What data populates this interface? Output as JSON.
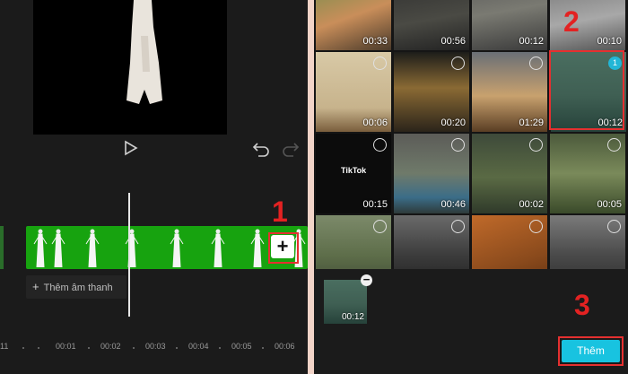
{
  "editor": {
    "timeline_ticks": [
      "11",
      "00:01",
      "00:02",
      "00:03",
      "00:04",
      "00:05",
      "00:06"
    ],
    "add_audio_label": "Thêm âm thanh",
    "add_clip_symbol": "+",
    "step_label_1": "1"
  },
  "media_picker": {
    "step_label_2": "2",
    "step_label_3": "3",
    "thumbnails": [
      {
        "duration": "00:33"
      },
      {
        "duration": "00:56"
      },
      {
        "duration": "00:12"
      },
      {
        "duration": "00:10"
      },
      {
        "duration": "00:06"
      },
      {
        "duration": "00:20"
      },
      {
        "duration": "01:29"
      },
      {
        "duration": "00:12",
        "selected_index": "1"
      },
      {
        "duration": "00:15",
        "logo_text": "TikTok"
      },
      {
        "duration": "00:46"
      },
      {
        "duration": "00:02"
      },
      {
        "duration": "00:05"
      },
      {
        "duration": ""
      },
      {
        "duration": ""
      },
      {
        "duration": ""
      },
      {
        "duration": ""
      }
    ],
    "selected_tray": [
      {
        "duration": "00:12",
        "remove_symbol": "−"
      }
    ],
    "add_button_label": "Thêm"
  },
  "colors": {
    "accent": "#18c3e0",
    "annotation_red": "#e32222",
    "green_screen": "#17a30f"
  },
  "icons": [
    "play-icon",
    "undo-icon",
    "redo-icon",
    "plus-icon",
    "remove-icon"
  ]
}
